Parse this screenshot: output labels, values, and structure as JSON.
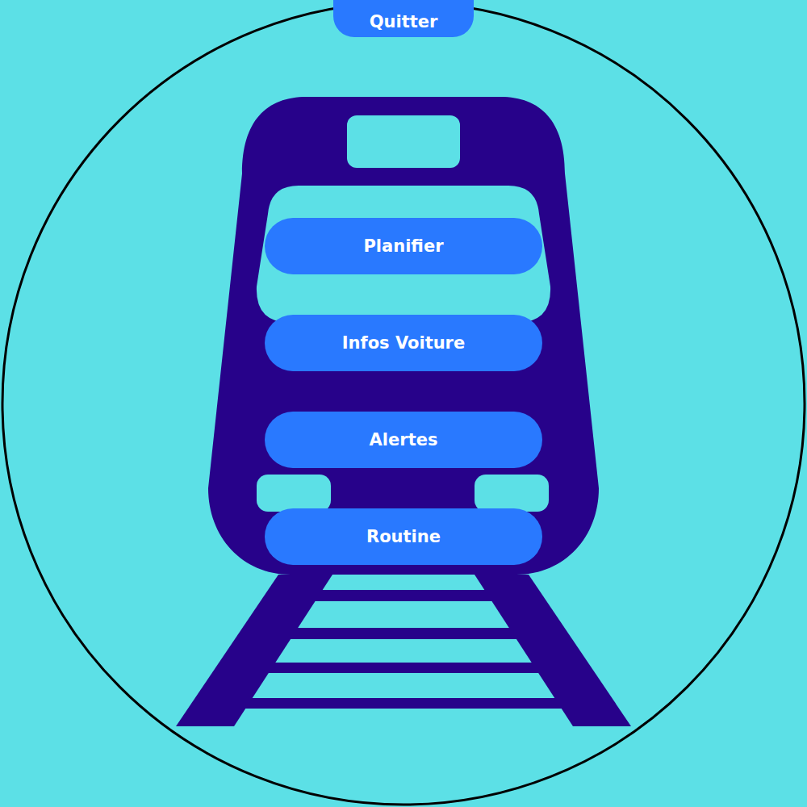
{
  "quit_button": {
    "label": "Quitter"
  },
  "menu": {
    "items": [
      {
        "label": "Planifier"
      },
      {
        "label": "Infos Voiture"
      },
      {
        "label": "Alertes"
      },
      {
        "label": "Routine"
      }
    ]
  }
}
